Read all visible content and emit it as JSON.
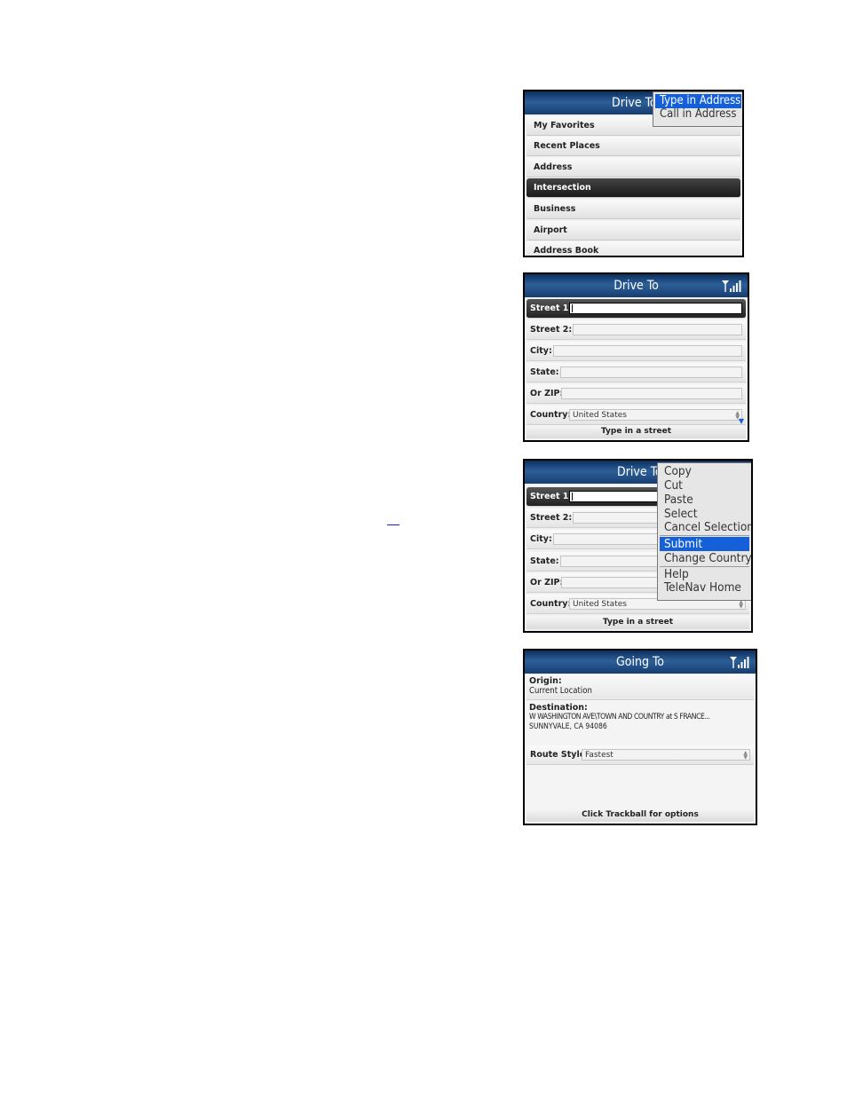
{
  "screens": [
    {
      "title": "Drive To",
      "popup": {
        "items": [
          "Type in Address",
          "Call in Address"
        ],
        "selected_index": 0
      },
      "menu_items": [
        "My Favorites",
        "Recent Places",
        "Address",
        "Intersection",
        "Business",
        "Airport",
        "Address Book"
      ],
      "selected_index": 3
    },
    {
      "title": "Drive To",
      "fields": [
        {
          "label": "Street 1:",
          "value": ""
        },
        {
          "label": "Street 2:",
          "value": ""
        },
        {
          "label": "City:",
          "value": ""
        },
        {
          "label": "State:",
          "value": ""
        },
        {
          "label": "Or ZIP:",
          "value": ""
        },
        {
          "label": "Country:",
          "value": "United States"
        }
      ],
      "status": "Type in a street"
    },
    {
      "title": "Drive To",
      "fields": [
        {
          "label": "Street 1:",
          "value": ""
        },
        {
          "label": "Street 2:",
          "value": ""
        },
        {
          "label": "City:",
          "value": ""
        },
        {
          "label": "State:",
          "value": ""
        },
        {
          "label": "Or ZIP:",
          "value": ""
        },
        {
          "label": "Country:",
          "value": "United States"
        }
      ],
      "context_menu": {
        "items": [
          "Copy",
          "Cut",
          "Paste",
          "Select",
          "Cancel Selection",
          "Submit",
          "Change Country",
          "Help",
          "TeleNav Home"
        ],
        "selected_index": 5
      },
      "status": "Type in a street"
    },
    {
      "title": "Going To",
      "origin_label": "Origin:",
      "origin_value": "Current Location",
      "destination_label": "Destination:",
      "destination_line1": "W WASHINGTON AVE\\TOWN AND COUNTRY at S FRANCE...",
      "destination_line2": "SUNNYVALE, CA 94086",
      "route_style_label": "Route Style:",
      "route_style_value": "Fastest",
      "status": "Click Trackball for options"
    }
  ],
  "icons": {
    "signal": "signal-strength-icon"
  }
}
